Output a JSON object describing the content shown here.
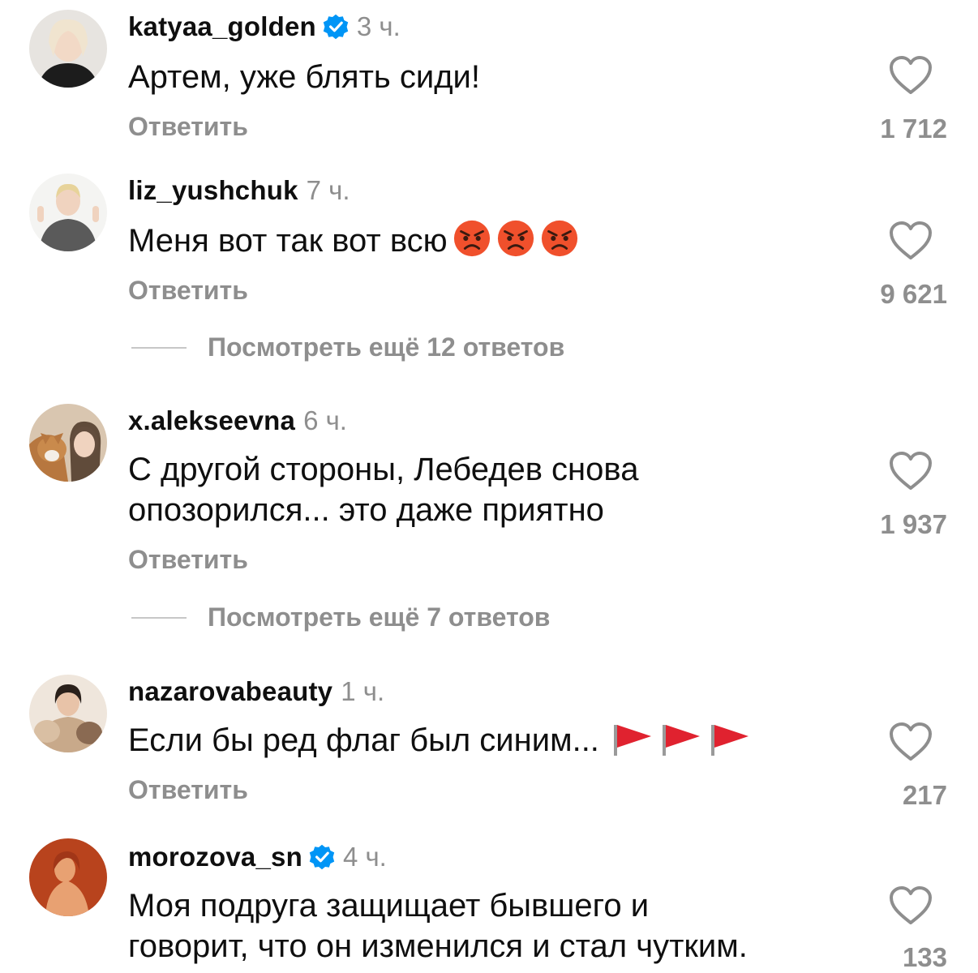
{
  "comments": [
    {
      "username": "katyaa_golden",
      "verified": true,
      "time": "3 ч.",
      "text": "Артем, уже блять сиди!",
      "reply_label": "Ответить",
      "likes": "1 712",
      "avatar_colors": [
        "#e7e4e0",
        "#1c1c1c"
      ]
    },
    {
      "username": "liz_yushchuk",
      "verified": false,
      "time": "7 ч.",
      "text": "Меня вот так вот всю",
      "emoji": [
        "angry-face",
        "angry-face",
        "angry-face"
      ],
      "reply_label": "Ответить",
      "likes": "9 621",
      "more_replies": "Посмотреть ещё 12 ответов",
      "avatar_colors": [
        "#f4f4f2",
        "#5a5a5a"
      ]
    },
    {
      "username": "x.alekseevna",
      "verified": false,
      "time": "6 ч.",
      "text_lines": [
        "С другой стороны, Лебедев снова",
        "опозорился... это даже приятно"
      ],
      "reply_label": "Ответить",
      "likes": "1 937",
      "more_replies": "Посмотреть ещё 7 ответов",
      "avatar_colors": [
        "#d9c6b0",
        "#b7773f"
      ]
    },
    {
      "username": "nazarovabeauty",
      "verified": false,
      "time": "1 ч.",
      "text": "Если бы ред флаг был синим...",
      "emoji": [
        "triangular-flag",
        "triangular-flag",
        "triangular-flag"
      ],
      "reply_label": "Ответить",
      "likes": "217",
      "avatar_colors": [
        "#efe6dc",
        "#8a6a52"
      ]
    },
    {
      "username": "morozova_sn",
      "verified": true,
      "time": "4 ч.",
      "text_lines": [
        "Моя подруга защищает бывшего и",
        "говорит, что он изменился и стал чутким."
      ],
      "likes": "133",
      "avatar_colors": [
        "#b8431d",
        "#e8a172"
      ]
    }
  ],
  "colors": {
    "verified_blue": "#0095f6",
    "secondary_text": "#8e8e8e",
    "angry_red": "#f0502c",
    "flag_red": "#e0222f"
  }
}
